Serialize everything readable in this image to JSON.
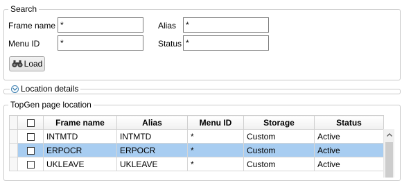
{
  "search": {
    "legend": "Search",
    "frame_name_label": "Frame name",
    "frame_name_value": "*",
    "alias_label": "Alias",
    "alias_value": "*",
    "menu_id_label": "Menu ID",
    "menu_id_value": "*",
    "status_label": "Status",
    "status_value": "*",
    "load_label": "Load",
    "load_icon": "binoculars-icon"
  },
  "location_details": {
    "label": "Location details",
    "icon": "chevron-down-circle-icon"
  },
  "topgen": {
    "legend": "TopGen page location",
    "columns": [
      "Frame name",
      "Alias",
      "Menu ID",
      "Storage",
      "Status"
    ],
    "rows": [
      {
        "frame_name": "INTMTD",
        "alias": "INTMTD",
        "menu_id": "*",
        "storage": "Custom",
        "status": "Active"
      },
      {
        "frame_name": "ERPOCR",
        "alias": "ERPOCR",
        "menu_id": "*",
        "storage": "Custom",
        "status": "Active"
      },
      {
        "frame_name": "UKLEAVE",
        "alias": "UKLEAVE",
        "menu_id": "*",
        "storage": "Custom",
        "status": "Active"
      }
    ],
    "selected_row_index": 1,
    "select_all_checked": false
  },
  "colors": {
    "selected_row": "#a8cdf1",
    "border": "#c8c8c8",
    "accent": "#3c7fb1"
  }
}
